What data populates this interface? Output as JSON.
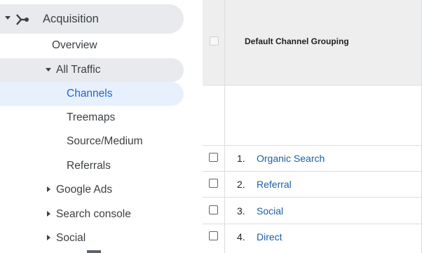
{
  "sidebar": {
    "section_label": "Acquisition",
    "section_icon": "acquisition-fork-icon",
    "items": {
      "overview": "Overview",
      "all_traffic": "All Traffic",
      "channels": "Channels",
      "treemaps": "Treemaps",
      "source_medium": "Source/Medium",
      "referrals": "Referrals",
      "google_ads": "Google Ads",
      "search_console": "Search console",
      "social": "Social"
    },
    "selected_item": "Channels",
    "accent_color": "#1967d2"
  },
  "table": {
    "column_header": "Default Channel Grouping",
    "rows": [
      {
        "index": "1.",
        "channel": "Organic Search"
      },
      {
        "index": "2.",
        "channel": "Referral"
      },
      {
        "index": "3.",
        "channel": "Social"
      },
      {
        "index": "4.",
        "channel": "Direct"
      }
    ],
    "link_color": "#1a5fa8"
  }
}
